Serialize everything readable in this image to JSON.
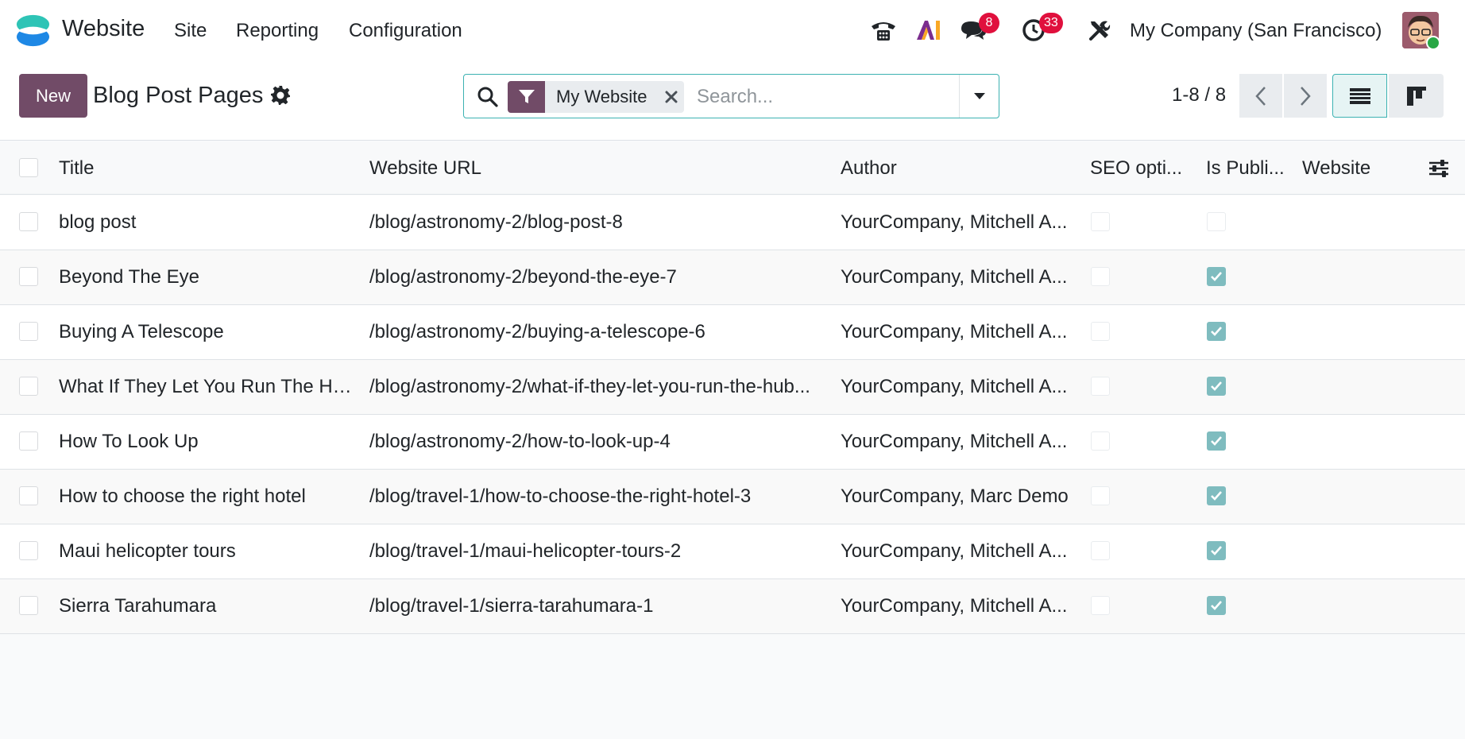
{
  "app": {
    "name": "Website"
  },
  "menu": {
    "items": [
      "Site",
      "Reporting",
      "Configuration"
    ]
  },
  "systray": {
    "messages_count": "8",
    "activities_count": "33",
    "company": "My Company (San Francisco)"
  },
  "controls": {
    "new_label": "New",
    "title": "Blog Post Pages",
    "search": {
      "facet": "My Website",
      "placeholder": "Search..."
    },
    "pager": "1-8 / 8"
  },
  "table": {
    "columns": [
      "Title",
      "Website URL",
      "Author",
      "SEO opti...",
      "Is Publi...",
      "Website"
    ],
    "rows": [
      {
        "title": "blog post",
        "url": "/blog/astronomy-2/blog-post-8",
        "author": "YourCompany, Mitchell A...",
        "seo": false,
        "published": false,
        "website": ""
      },
      {
        "title": "Beyond The Eye",
        "url": "/blog/astronomy-2/beyond-the-eye-7",
        "author": "YourCompany, Mitchell A...",
        "seo": false,
        "published": true,
        "website": ""
      },
      {
        "title": "Buying A Telescope",
        "url": "/blog/astronomy-2/buying-a-telescope-6",
        "author": "YourCompany, Mitchell A...",
        "seo": false,
        "published": true,
        "website": ""
      },
      {
        "title": "What If They Let You Run The Hu...",
        "url": "/blog/astronomy-2/what-if-they-let-you-run-the-hub...",
        "author": "YourCompany, Mitchell A...",
        "seo": false,
        "published": true,
        "website": ""
      },
      {
        "title": "How To Look Up",
        "url": "/blog/astronomy-2/how-to-look-up-4",
        "author": "YourCompany, Mitchell A...",
        "seo": false,
        "published": true,
        "website": ""
      },
      {
        "title": "How to choose the right hotel",
        "url": "/blog/travel-1/how-to-choose-the-right-hotel-3",
        "author": "YourCompany, Marc Demo",
        "seo": false,
        "published": true,
        "website": ""
      },
      {
        "title": "Maui helicopter tours",
        "url": "/blog/travel-1/maui-helicopter-tours-2",
        "author": "YourCompany, Mitchell A...",
        "seo": false,
        "published": true,
        "website": ""
      },
      {
        "title": "Sierra Tarahumara",
        "url": "/blog/travel-1/sierra-tarahumara-1",
        "author": "YourCompany, Mitchell A...",
        "seo": false,
        "published": true,
        "website": ""
      }
    ]
  },
  "colors": {
    "brand": "#714b67",
    "accent": "#3cb2b2",
    "badge": "#e0103d",
    "checked": "#7fbcbf"
  }
}
